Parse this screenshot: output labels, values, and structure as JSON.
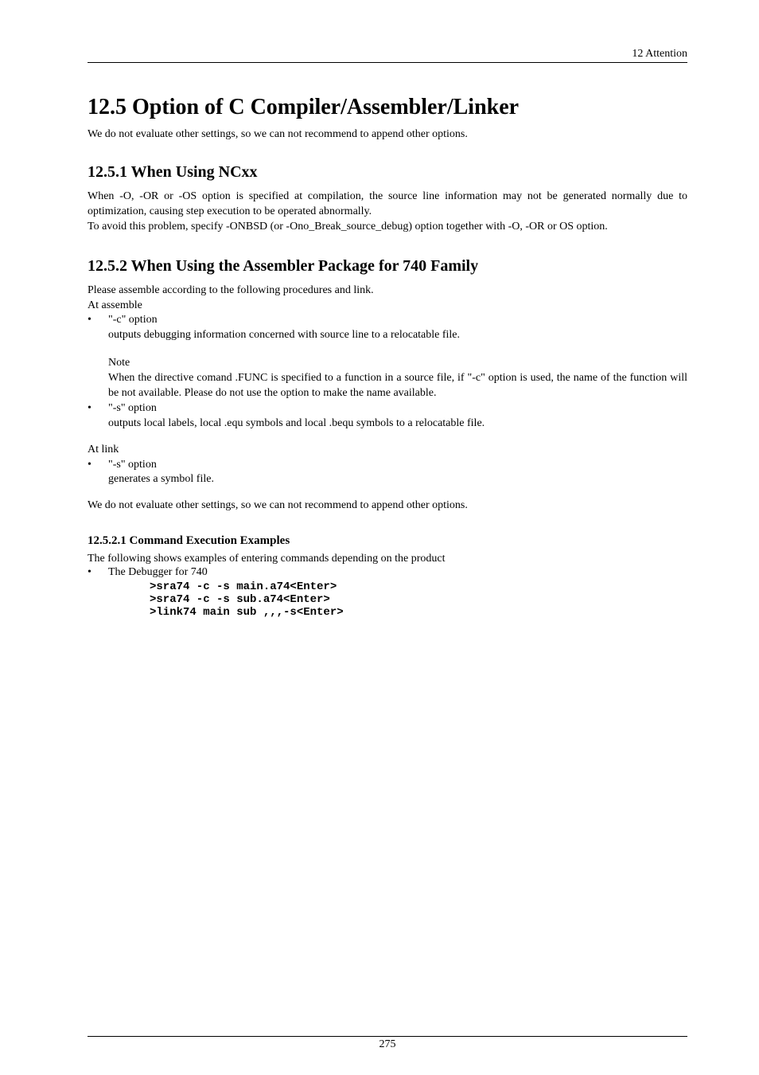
{
  "header": {
    "label": "12 Attention"
  },
  "title": "12.5 Option of C Compiler/Assembler/Linker",
  "intro": "We do not evaluate other settings, so we can not recommend to append other options.",
  "s1": {
    "heading": "12.5.1 When Using NCxx",
    "body": "When -O, -OR or -OS option is specified at compilation, the source line information may not be generated normally due to optimization, causing step execution to be operated abnormally.\nTo avoid this problem, specify -ONBSD (or -Ono_Break_source_debug) option together with -O, -OR or OS option."
  },
  "s2": {
    "heading": "12.5.2 When Using the Assembler Package for 740 Family",
    "intro1": "Please assemble according to the following procedures and link.",
    "intro2": "At assemble",
    "b1": {
      "label": "\"-c\" option",
      "desc": "outputs debugging information concerned with source line to a relocatable file."
    },
    "note": {
      "label": "Note",
      "text": "When the directive comand .FUNC is specified to a function in a source file, if \"-c\" option is used, the name of the function will be not available. Please do not use the option to make the name available."
    },
    "b2": {
      "label": "\"-s\" option",
      "desc": "outputs local labels, local .equ symbols and local .bequ symbols to a relocatable file."
    },
    "atlink": "At link",
    "b3": {
      "label": "\"-s\" option",
      "desc": "generates a symbol file."
    },
    "outro": "We do not evaluate other settings, so we can not recommend to append other options.",
    "cmd": {
      "heading": "12.5.2.1 Command Execution Examples",
      "intro": "The following shows examples of entering commands depending on the product",
      "b1": "The Debugger for 740",
      "l1": ">sra74 -c -s main.a74<Enter>",
      "l2": ">sra74 -c -s sub.a74<Enter>",
      "l3": ">link74 main sub ,,,-s<Enter>"
    }
  },
  "footer": {
    "page": "275"
  }
}
